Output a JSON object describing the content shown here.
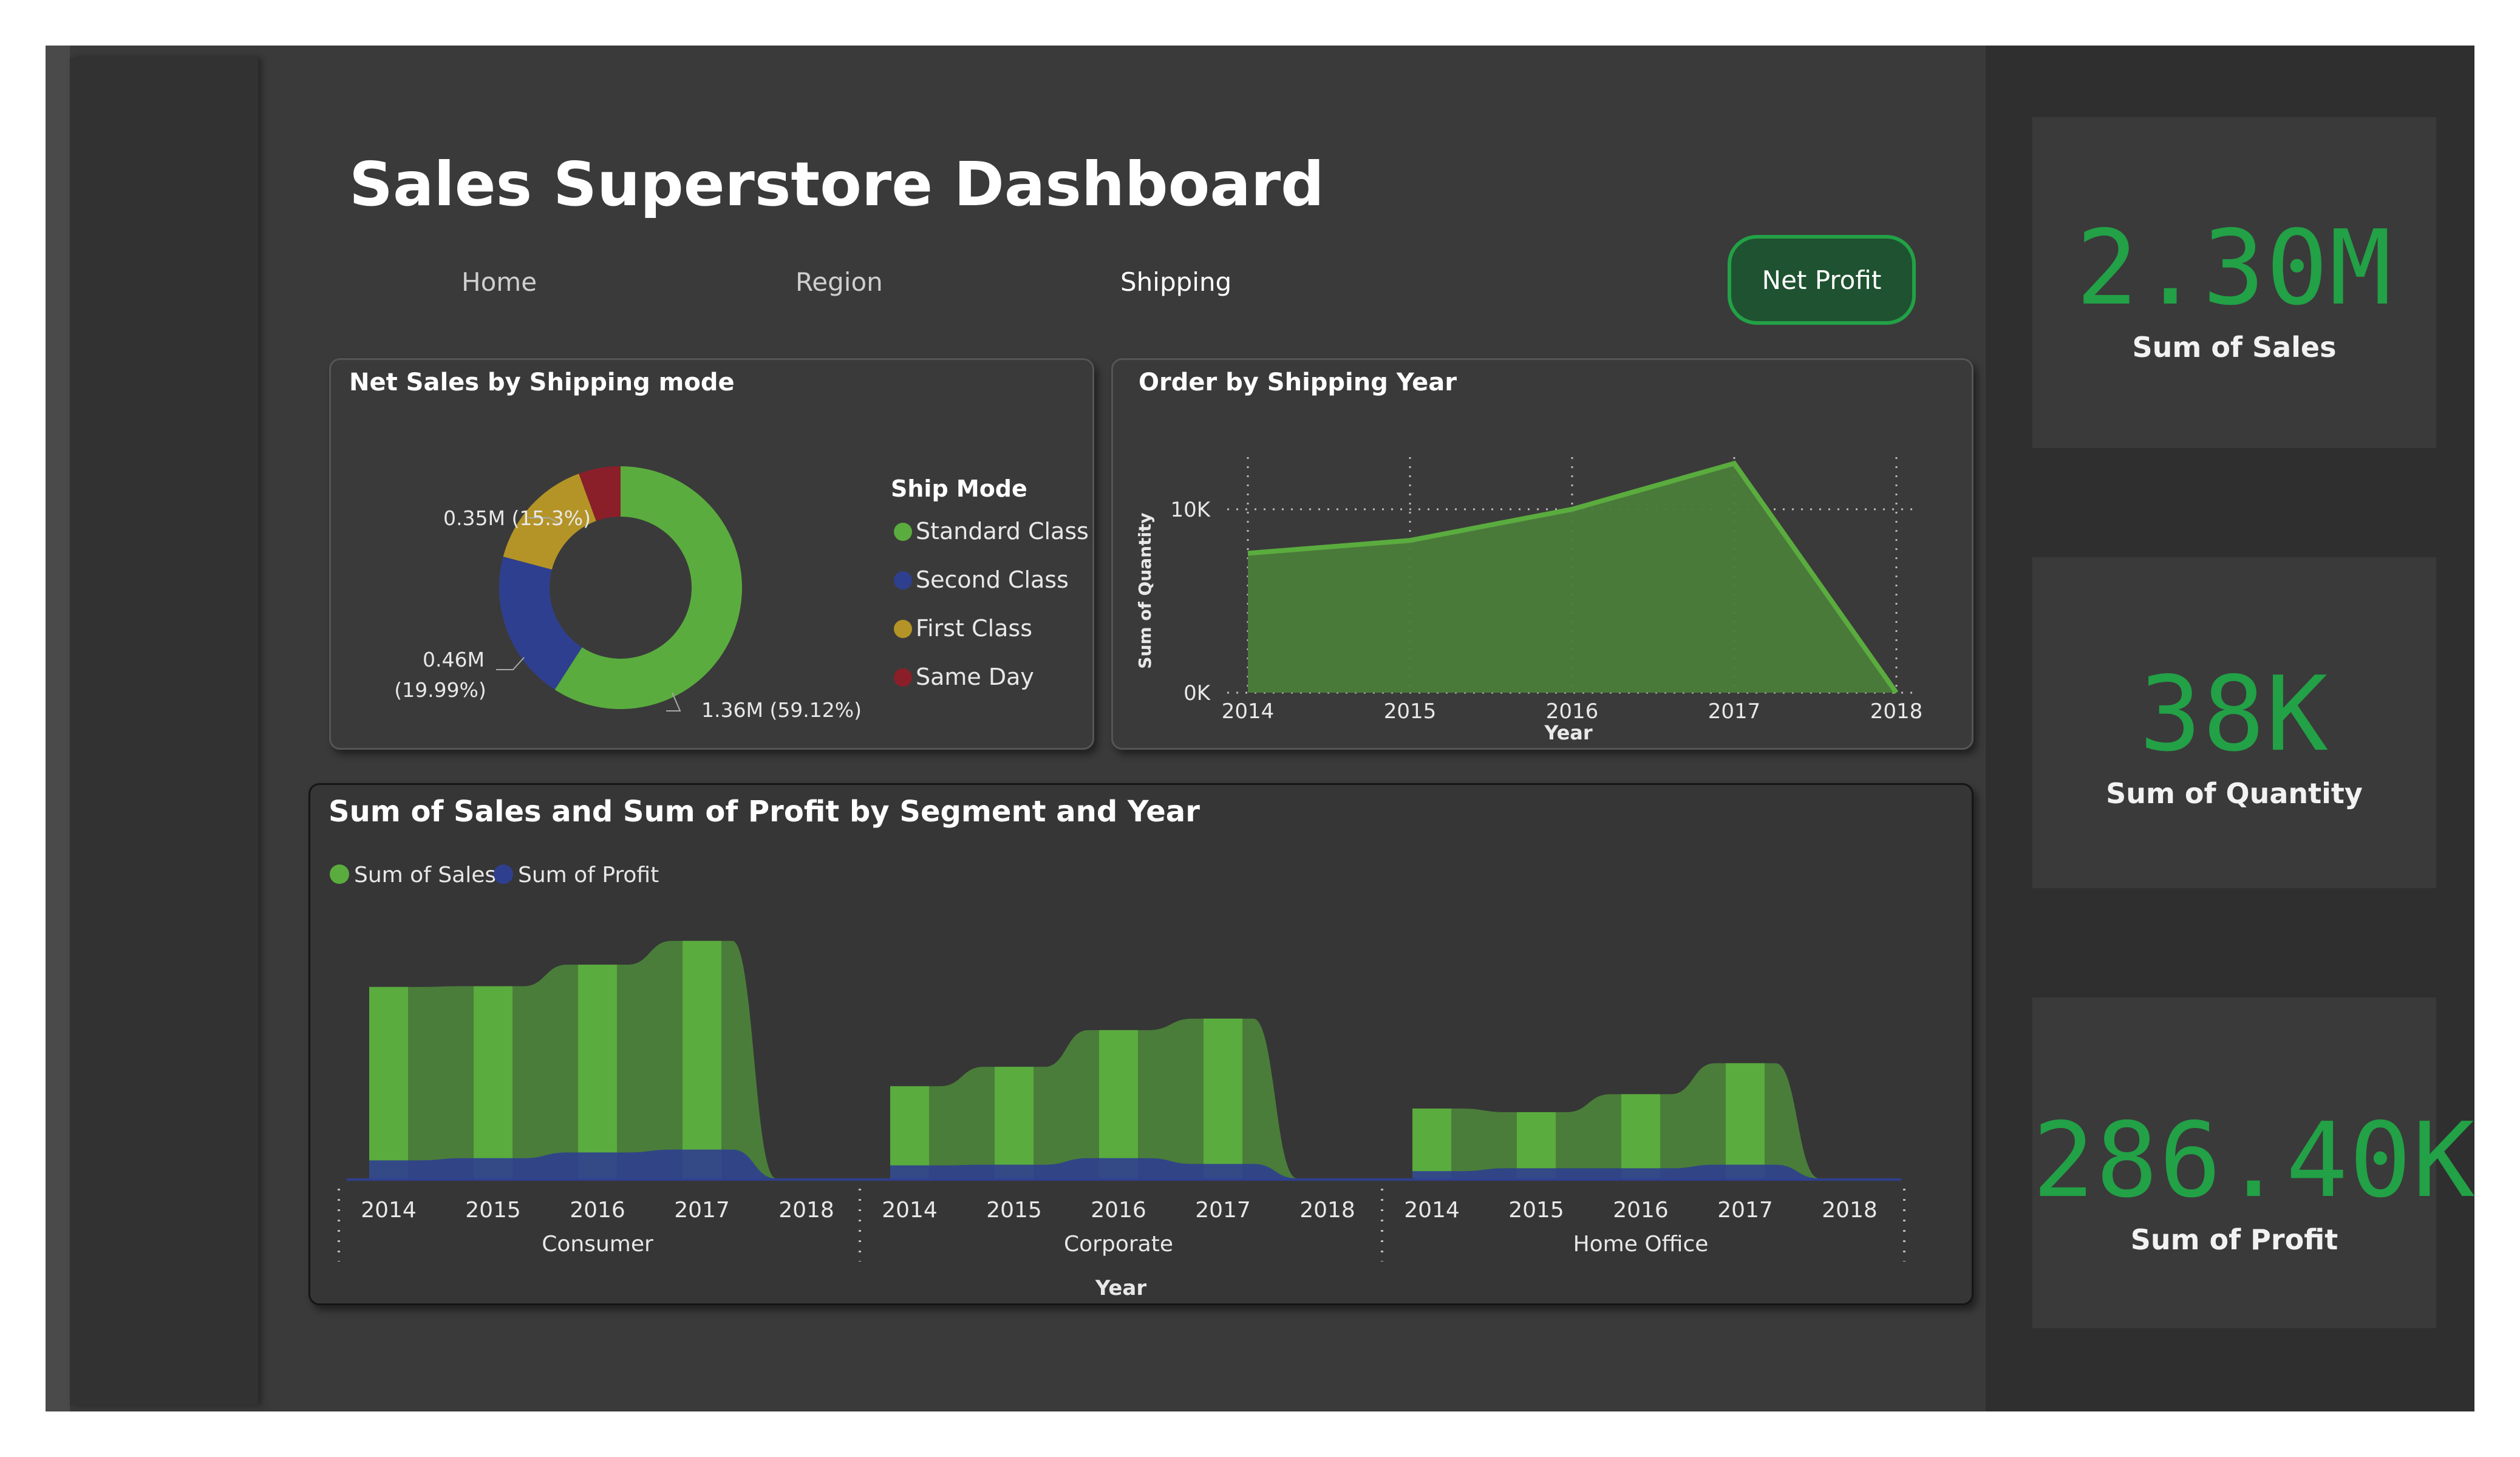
{
  "dashboard": {
    "title": "Sales Superstore Dashboard",
    "nav": [
      "Home",
      "Region",
      "Shipping"
    ],
    "net_profit_button": "Net Profit"
  },
  "kpis": [
    {
      "value": "2.30M",
      "label": "Sum of Sales"
    },
    {
      "value": "38K",
      "label": "Sum of Quantity"
    },
    {
      "value": "286.40K",
      "label": "Sum of Profit"
    }
  ],
  "colors": {
    "accent": "#22a146",
    "standard_class": "#5aac3e",
    "second_class": "#2f3f8f",
    "first_class": "#b49426",
    "same_day": "#8a1f2a",
    "area_fill": "#4a7d3a",
    "sales_bar": "#5aac3e"
  },
  "chart_data": [
    {
      "type": "pie",
      "title": "Net Sales by Shipping mode",
      "legend_title": "Ship Mode",
      "slices": [
        {
          "name": "Standard Class",
          "share": 59.12,
          "value_label": "1.36M (59.12%)"
        },
        {
          "name": "Second Class",
          "share": 19.99,
          "value_label": "0.46M (19.99%)",
          "value_label_lines": [
            "0.46M",
            "(19.99%)"
          ]
        },
        {
          "name": "First Class",
          "share": 15.3,
          "value_label": "0.35M (15.3%)"
        },
        {
          "name": "Same Day",
          "share": 5.59,
          "value_label": ""
        }
      ],
      "legend_placement": "right"
    },
    {
      "type": "area",
      "title": "Order by Shipping Year",
      "xlabel": "Year",
      "ylabel": "Sum of Quantity",
      "x": [
        "2014",
        "2015",
        "2016",
        "2017",
        "2018"
      ],
      "y": [
        7600,
        8300,
        10000,
        12500,
        0
      ],
      "yticks": [
        {
          "value": 0,
          "label": "0K"
        },
        {
          "value": 10000,
          "label": "10K"
        }
      ],
      "ylim": [
        0,
        14000
      ],
      "grid": true
    },
    {
      "type": "area",
      "title": "Sum of Sales and Sum of Profit by Segment and Year",
      "xlabel": "Year",
      "legend": [
        "Sum of Sales",
        "Sum of Profit"
      ],
      "legend_placement": "top-left",
      "groups": [
        {
          "name": "Consumer",
          "x": [
            "2014",
            "2015",
            "2016",
            "2017",
            "2018"
          ],
          "sales": [
            266000,
            267000,
            297000,
            330000,
            0
          ],
          "profit": [
            25000,
            28000,
            36000,
            40000,
            0
          ]
        },
        {
          "name": "Corporate",
          "x": [
            "2014",
            "2015",
            "2016",
            "2017",
            "2018"
          ],
          "sales": [
            128000,
            155000,
            206000,
            222000,
            0
          ],
          "profit": [
            18000,
            19000,
            28000,
            20000,
            0
          ]
        },
        {
          "name": "Home Office",
          "x": [
            "2014",
            "2015",
            "2016",
            "2017",
            "2018"
          ],
          "sales": [
            97000,
            92000,
            117000,
            160000,
            0
          ],
          "profit": [
            10000,
            14000,
            14000,
            19000,
            0
          ]
        }
      ]
    }
  ]
}
